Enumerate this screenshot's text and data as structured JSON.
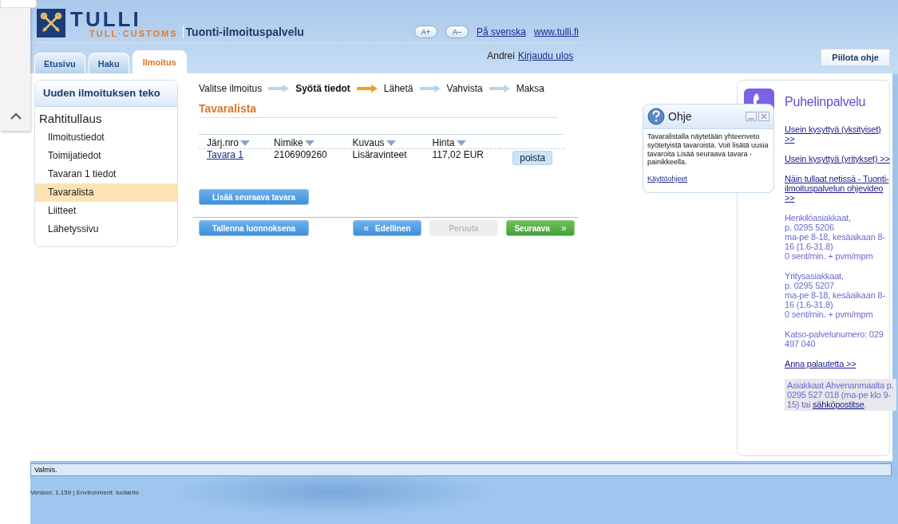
{
  "header": {
    "logo_title": "TULLI",
    "logo_subtitle": "TULL·CUSTOMS",
    "service_name": "Tuonti-ilmoituspalvelu",
    "font_buttons": [
      "A+",
      "A–"
    ],
    "links": [
      "På svenska",
      "www.tulli.fi"
    ]
  },
  "tabs": [
    {
      "label": "Etusivu",
      "selected": false
    },
    {
      "label": "Haku",
      "selected": false
    },
    {
      "label": "Ilmoitus",
      "selected": true
    }
  ],
  "user": {
    "name": "Andrei",
    "logout": "Kirjaudu ulos"
  },
  "hide_help_button": "Piilota ohje",
  "sidebar": {
    "title": "Uuden ilmoituksen teko",
    "section": "Rahtitullaus",
    "items": [
      {
        "label": "Ilmoitustiedot",
        "selected": false
      },
      {
        "label": "Toimijatiedot",
        "selected": false
      },
      {
        "label": "Tavaran 1 tiedot",
        "selected": false
      },
      {
        "label": "Tavaralista",
        "selected": true
      },
      {
        "label": "Liitteet",
        "selected": false
      },
      {
        "label": "Lähetyssivu",
        "selected": false
      }
    ]
  },
  "steps": [
    {
      "label": "Valitse ilmoitus",
      "current": false
    },
    {
      "label": "Syötä tiedot",
      "current": true
    },
    {
      "label": "Lähetä",
      "current": false
    },
    {
      "label": "Vahvista",
      "current": false
    },
    {
      "label": "Maksa",
      "current": false
    }
  ],
  "section_title": "Tavaralista",
  "table": {
    "columns": [
      "Järj.nro",
      "Nimike",
      "Kuvaus",
      "Hinta"
    ],
    "rows": [
      {
        "cells": [
          "Tavara 1",
          "2106909260",
          "Lisäravinteet",
          "117,02 EUR"
        ],
        "action": "poista"
      }
    ]
  },
  "add_button": "Lisää seuraava tavara",
  "buttons": [
    {
      "kind": "save",
      "label": "Tallenna luonnoksena",
      "disabled": false
    },
    {
      "kind": "previous",
      "label": "Edellinen",
      "icon": "«",
      "disabled": false
    },
    {
      "kind": "cancel",
      "label": "Peruuta",
      "disabled": true
    },
    {
      "kind": "next",
      "label": "Seuraava",
      "icon": "»",
      "disabled": false
    }
  ],
  "help_popup": {
    "title": "Ohje",
    "text": "Tavaralistalla näytetään yhteenveto syötetyistä tavaroista. Voit lisätä uusia tavaroita Lisää seuraava tavara -painikkeella.",
    "link": "Käyttöohjeet"
  },
  "phone_panel": {
    "title": "Puhelinpalvelu",
    "content": [
      {
        "kind": "link",
        "text": "Usein kysyttyä (yksityiset) >>"
      },
      {
        "kind": "link",
        "text": "Usein kysyttyä (yritykset) >>"
      },
      {
        "kind": "link",
        "text": "Näin tullaat netissä - Tuonti-ilmoituspalvelun ohjevideo >>"
      },
      {
        "kind": "text",
        "lines": [
          "Henkilöasiakkaat,",
          "p. 0295 5206",
          "ma-pe 8-18, kesäaikaan 8-16 (1.6-31.8)",
          "0 sent/min. + pvm/mpm"
        ]
      },
      {
        "kind": "text",
        "lines": [
          "Yritysasiakkaat,",
          "p. 0295 5207",
          "ma-pe 8-18, kesäaikaan 8-16 (1.6-31.8)",
          "0 sent/min. + pvm/mpm"
        ]
      },
      {
        "kind": "text",
        "lines": [
          "Katso-palvelunumero: 029 497 040"
        ]
      },
      {
        "kind": "link",
        "text": "Anna palautetta >>"
      },
      {
        "kind": "note",
        "text": "Asiakkaat Ahvenanmaalta p. 0295 527 018 (ma-pe klo 9-15) tai",
        "link": "sähköpostitse",
        "after": "."
      }
    ]
  },
  "status_bar": "Valmis.",
  "version": "Version: 1.159 | Environment: tuotanto"
}
